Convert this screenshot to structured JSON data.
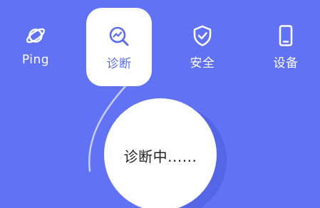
{
  "colors": {
    "background": "#6173f4",
    "active_tab_bg": "#ffffff",
    "active_accent": "#5a6df2",
    "inactive_text": "#ffffff"
  },
  "tabs": [
    {
      "label": "Ping",
      "icon": "planet-icon",
      "active": false
    },
    {
      "label": "诊断",
      "icon": "diagnose-search-icon",
      "active": true
    },
    {
      "label": "安全",
      "icon": "shield-check-icon",
      "active": false
    },
    {
      "label": "设备",
      "icon": "phone-icon",
      "active": false
    }
  ],
  "status": {
    "text": "诊断中......"
  }
}
